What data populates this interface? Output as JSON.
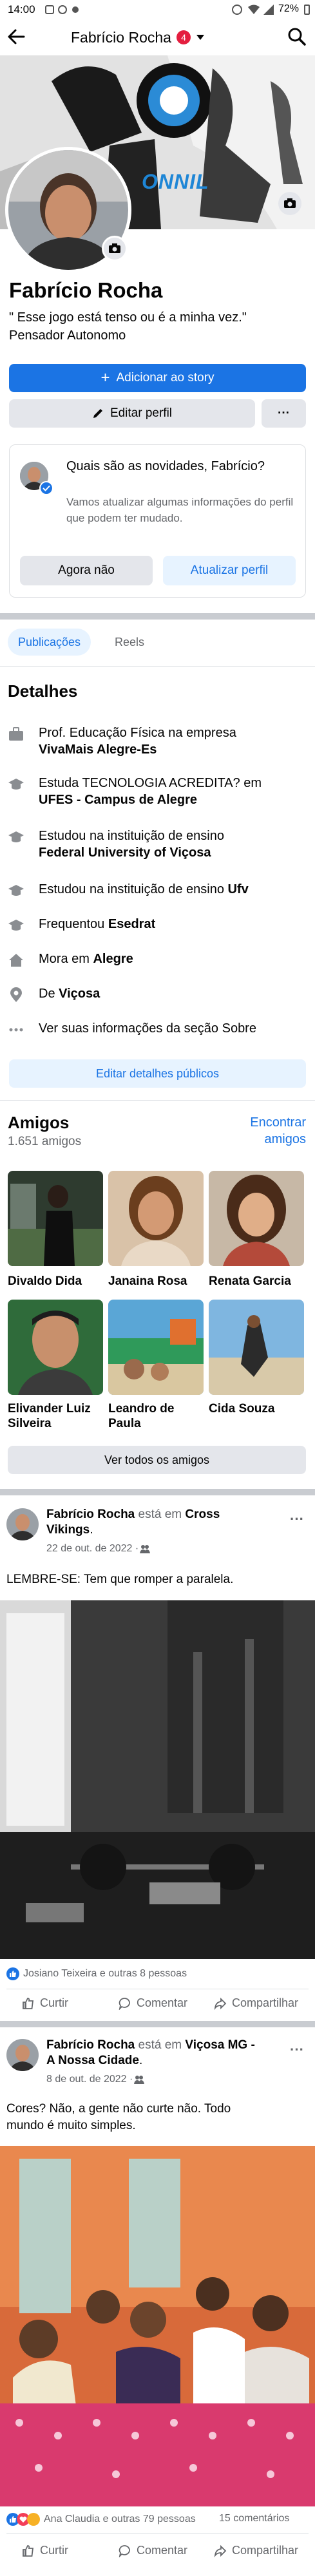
{
  "status": {
    "time": "14:00",
    "battery": "72%"
  },
  "topbar": {
    "title": "Fabrício Rocha",
    "badge": "4"
  },
  "cover": {
    "brand_text": "ONNIL"
  },
  "profile": {
    "name": "Fabrício Rocha",
    "bio": "\" Esse jogo está tenso ou é a minha vez.\"",
    "occupation": "Pensador Autonomo",
    "add_story": "Adicionar ao story",
    "edit_profile": "Editar perfil",
    "more": "···"
  },
  "update_card": {
    "title": "Quais são as novidades, Fabrício?",
    "text": "Vamos atualizar algumas informações do perfil que podem ter mudado.",
    "not_now": "Agora não",
    "update": "Atualizar perfil"
  },
  "tabs": {
    "posts": "Publicações",
    "reels": "Reels"
  },
  "details": {
    "title": "Detalhes",
    "work_prefix": "Prof. Educação Física na empresa ",
    "work_place": "VivaMais Alegre-Es",
    "edu1_prefix": "Estuda TECNOLOGIA ACREDITA? em ",
    "edu1_place": "UFES - Campus de Alegre",
    "edu2_prefix": "Estudou na instituição de ensino ",
    "edu2_place": "Federal University of Viçosa",
    "edu3_prefix": "Estudou na instituição de ensino ",
    "edu3_place": "Ufv",
    "school_prefix": "Frequentou ",
    "school_place": "Esedrat",
    "lives_prefix": "Mora em ",
    "lives_place": "Alegre",
    "from_prefix": "De ",
    "from_place": "Viçosa",
    "about_link": "Ver suas informações da seção Sobre",
    "edit_public": "Editar detalhes públicos"
  },
  "friends": {
    "title": "Amigos",
    "count": "1.651 amigos",
    "find_line1": "Encontrar",
    "find_line2": "amigos",
    "items": [
      {
        "name": "Divaldo Dida"
      },
      {
        "name": "Janaina Rosa"
      },
      {
        "name": "Renata Garcia"
      },
      {
        "name_line1": "Elivander Luiz",
        "name_line2": "Silveira"
      },
      {
        "name_line1": "Leandro de",
        "name_line2": "Paula"
      },
      {
        "name": "Cida Souza"
      }
    ],
    "see_all": "Ver todos os amigos"
  },
  "post1": {
    "author": "Fabrício Rocha",
    "at_word": " está em ",
    "place_line1": "Cross",
    "place_line2": "Vikings",
    "date": "22 de out. de 2022 · ",
    "text": "LEMBRE-SE: Tem que romper a paralela.",
    "reactions": "Josiano Teixeira e outras 8 pessoas",
    "like": "Curtir",
    "comment": "Comentar",
    "share": "Compartilhar"
  },
  "post2": {
    "author": "Fabrício Rocha",
    "at_word": " está em ",
    "place_line1": "Viçosa MG -",
    "place_line2": "A Nossa Cidade",
    "date": "8 de out. de 2022 · ",
    "text_line1": "Cores? Não,  a gente não curte não. Todo",
    "text_line2": "mundo é muito simples.",
    "reactions": "Ana Claudia e outras 79 pessoas",
    "comments": "15 comentários",
    "like": "Curtir",
    "comment": "Comentar",
    "share": "Compartilhar"
  },
  "colors": {
    "accent": "#1b74e4",
    "badge": "#e41e3f",
    "grey_button": "#e4e6eb",
    "separator": "#c9ccd1"
  }
}
